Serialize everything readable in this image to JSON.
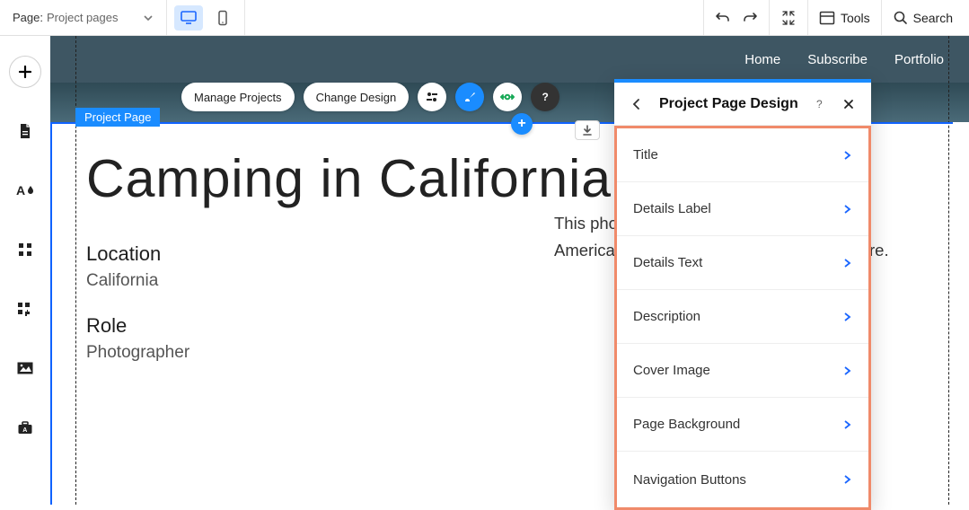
{
  "topbar": {
    "page_label": "Page:",
    "page_value": "Project pages",
    "tools_label": "Tools",
    "search_label": "Search"
  },
  "site_nav": {
    "home": "Home",
    "subscribe": "Subscribe",
    "portfolio": "Portfolio"
  },
  "selection_label": "Project Page",
  "floating_toolbar": {
    "manage": "Manage Projects",
    "change": "Change Design"
  },
  "page": {
    "title": "Camping in California",
    "location_label": "Location",
    "location_value": "California",
    "role_label": "Role",
    "role_value": "Photographer",
    "description_line1": "This pho",
    "description_line2": "America",
    "description_tail": "re."
  },
  "design_panel": {
    "title": "Project Page Design",
    "items": [
      {
        "label": "Title"
      },
      {
        "label": "Details Label"
      },
      {
        "label": "Details Text"
      },
      {
        "label": "Description"
      },
      {
        "label": "Cover Image"
      },
      {
        "label": "Page Background"
      },
      {
        "label": "Navigation Buttons"
      }
    ]
  }
}
